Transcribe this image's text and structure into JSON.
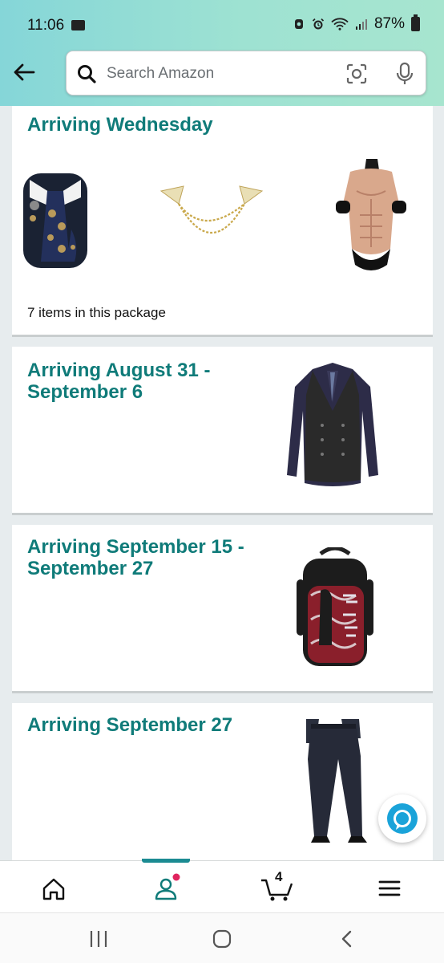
{
  "status_bar": {
    "time": "11:06",
    "battery": "87%"
  },
  "search": {
    "placeholder": "Search Amazon"
  },
  "shipments": [
    {
      "title_lines": [
        "Arriving Wednesday"
      ],
      "subtitle": "7 items in this package",
      "images": [
        "paisley-tie-set",
        "collar-chain-pin",
        "muscle-bodysuit"
      ]
    },
    {
      "title_lines": [
        "Arriving August 31 -",
        "September 6"
      ],
      "images": [
        "double-breasted-vest"
      ]
    },
    {
      "title_lines": [
        "Arriving September 15 -",
        "September 27"
      ],
      "images": [
        "printed-backpack"
      ]
    },
    {
      "title_lines": [
        "Arriving September 27"
      ],
      "images": [
        "dress-pants"
      ]
    }
  ],
  "bottom_nav": {
    "cart_count": "4",
    "items": [
      "home-icon",
      "account-icon",
      "cart-icon",
      "menu-icon"
    ]
  },
  "colors": {
    "accent": "#0f7b79",
    "header_start": "#85d6d8",
    "header_end": "#a7e5cf",
    "alexa": "#1aa3d9"
  }
}
